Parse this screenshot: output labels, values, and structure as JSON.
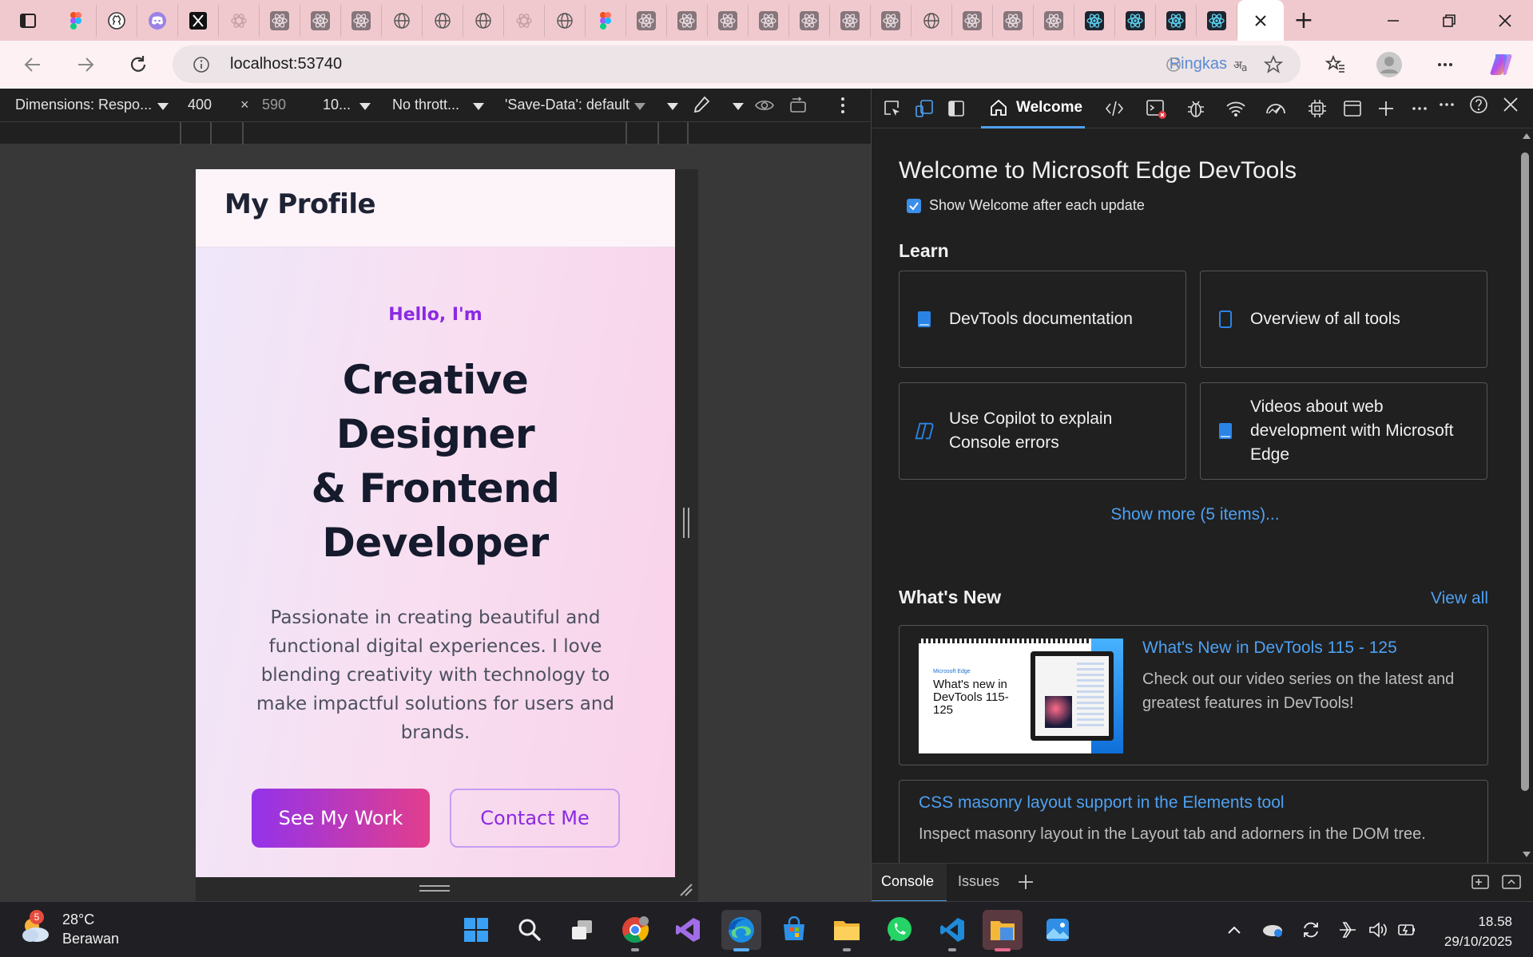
{
  "browser": {
    "tab_icons": [
      "figma-icon",
      "github-icon",
      "discord-icon",
      "x-icon",
      "openai-icon",
      "react-icon",
      "react-icon",
      "react-icon",
      "globe-icon",
      "globe-icon",
      "globe-icon",
      "openai-icon",
      "globe-icon",
      "figma-icon",
      "react-icon",
      "react-icon",
      "react-icon",
      "react-icon",
      "react-icon",
      "react-icon",
      "react-icon",
      "globe-icon",
      "react-icon",
      "react-icon",
      "react-icon",
      "react-dark-icon",
      "react-dark-icon",
      "react-dark-icon",
      "react-dark-icon"
    ],
    "address": {
      "url": "localhost:53740",
      "read_aloud_label": "Ringkas"
    }
  },
  "device_toolbar": {
    "dimensions_label": "Dimensions: Respo...",
    "width": "400",
    "times": "×",
    "height": "590",
    "zoom": "10...",
    "throttle": "No thrott...",
    "save_data": "'Save-Data': default"
  },
  "site": {
    "logo": "My Profile",
    "hello": "Hello, I'm",
    "headline_lines": [
      "Creative",
      "Designer",
      "& Frontend",
      "Developer"
    ],
    "bio": "Passionate in creating beautiful and functional digital experiences. I love blending creativity with technology to make impactful solutions for users and brands.",
    "primary_button": "See My Work",
    "secondary_button": "Contact Me"
  },
  "devtools": {
    "active_tab": "Welcome",
    "title": "Welcome to Microsoft Edge DevTools",
    "show_welcome_label": "Show Welcome after each update",
    "show_welcome_checked": true,
    "learn_heading": "Learn",
    "learn_cards": [
      {
        "label": "DevTools documentation",
        "icon": "book-icon"
      },
      {
        "label": "Overview of all tools",
        "icon": "book-outline-icon"
      },
      {
        "label": "Use Copilot to explain Console errors",
        "icon": "copilot-icon"
      },
      {
        "label": "Videos about web development with Microsoft Edge",
        "icon": "book-icon"
      }
    ],
    "show_more": "Show more (5 items)...",
    "whats_new_heading": "What's New",
    "view_all": "View all",
    "news": [
      {
        "title": "What's New in DevTools 115 - 125",
        "description": "Check out our video series on the latest and greatest features in DevTools!",
        "thumb_brand": "Microsoft Edge",
        "thumb_title": "What's new in DevTools 115-125"
      },
      {
        "title": "CSS masonry layout support in the Elements tool",
        "description": "Inspect masonry layout in the Layout tab and adorners in the DOM tree."
      }
    ],
    "drawer_tabs": [
      "Console",
      "Issues"
    ]
  },
  "taskbar": {
    "weather_temp": "28°C",
    "weather_desc": "Berawan",
    "weather_badge": "5",
    "time": "18.58",
    "date": "29/10/2025"
  },
  "colors": {
    "accent_purple": "#8a2ae3",
    "gradient_start": "#9333ea",
    "gradient_end": "#e23e8c",
    "devtools_link": "#4ea1f3",
    "tabstrip": "#f0c9ce"
  }
}
